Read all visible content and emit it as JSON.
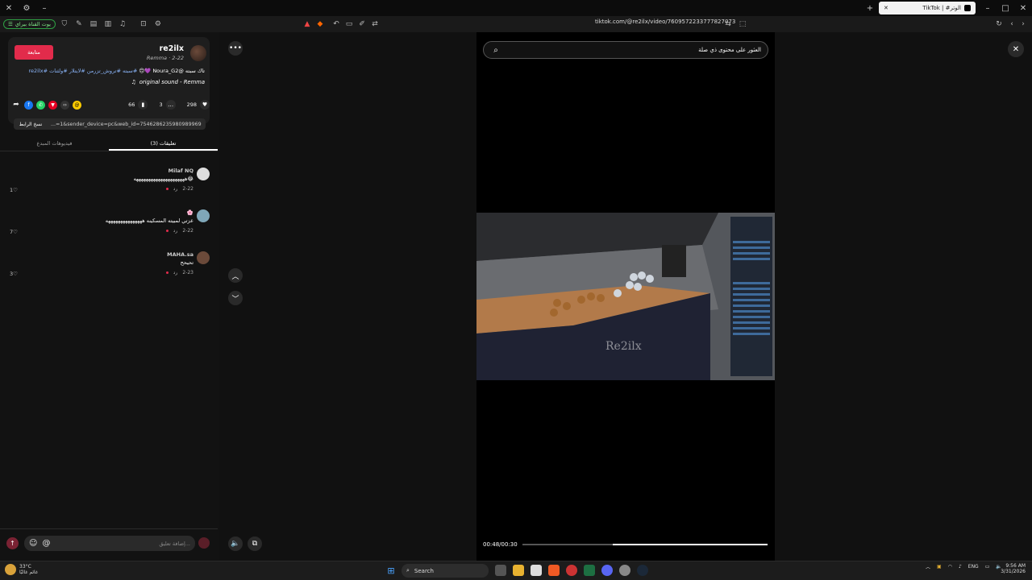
{
  "window": {
    "tab_title": "TikTok | #الوتر"
  },
  "toolbar": {
    "yt_button": "يوت القناة بيراي",
    "url": "tiktok.com/@re2ilx/video/7609572233777827073"
  },
  "author": {
    "follow": "متابعة",
    "name": "re2ilx",
    "sub": "Remma · 2-22",
    "caption_prefix": "تاك سبته @Noura_G2",
    "caption_tags": "#سبته #تروش_تزرمن #لايتلار #ولثنات #re2ilx",
    "sound": "original sound - Remma"
  },
  "stats": {
    "likes": "298",
    "comments": "3",
    "saves": "66"
  },
  "share": {
    "copy_label": "نسخ الرابط",
    "link": "...=1&sender_device=pc&web_id=7546286235980989969"
  },
  "tabs": {
    "comments": "تعليقات (3)",
    "creator_videos": "فيديوهات المبدع"
  },
  "comments": [
    {
      "user": "Milaf NQ",
      "text": "😂هههههههههههههههههههههه",
      "date": "2-22",
      "reply": "رد",
      "likes": "1"
    },
    {
      "user": "🌸",
      "text": "عزتي لمبيته المسكينه هههههههههههههههه",
      "date": "2-22",
      "reply": "رد",
      "likes": "7"
    },
    {
      "user": "MAHA.sa",
      "text": "تحيحح",
      "date": "2-23",
      "reply": "رد",
      "likes": "3"
    }
  ],
  "comment_input": {
    "placeholder": "إضافة تعليق..."
  },
  "search": {
    "text": "العثور على محتوى ذي صلة"
  },
  "video": {
    "time": "00:48/00:30",
    "watermark": "Re2ilx",
    "progress": 0.63
  },
  "taskbar": {
    "weather_temp": "33°C",
    "weather_desc": "غائم غالبًا",
    "search_label": "Search",
    "lang": "ENG",
    "time": "9:56 AM",
    "date": "3/31/2026"
  }
}
